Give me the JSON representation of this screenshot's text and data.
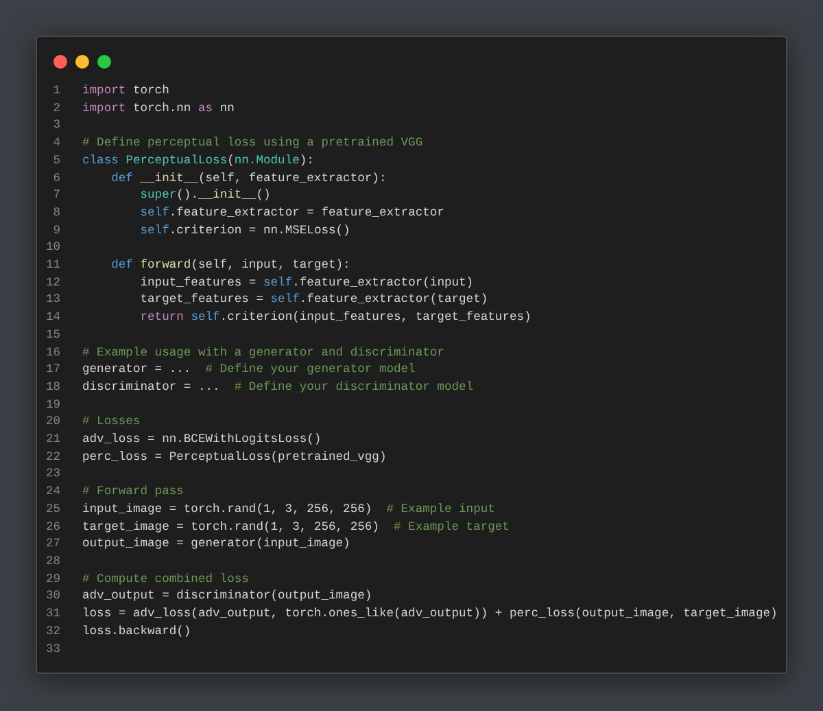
{
  "window": {
    "buttons": [
      {
        "kind": "close"
      },
      {
        "kind": "minimize"
      },
      {
        "kind": "zoom"
      }
    ]
  },
  "lines": [
    {
      "number": "1",
      "tokens": [
        {
          "kind": "kw",
          "text": "import"
        },
        {
          "kind": "tx",
          "text": " torch"
        }
      ]
    },
    {
      "number": "2",
      "tokens": [
        {
          "kind": "kw",
          "text": "import"
        },
        {
          "kind": "tx",
          "text": " torch.nn "
        },
        {
          "kind": "kw",
          "text": "as"
        },
        {
          "kind": "tx",
          "text": " nn"
        }
      ]
    },
    {
      "number": "3"
    },
    {
      "number": "4",
      "tokens": [
        {
          "kind": "cm",
          "text": "# Define perceptual loss using a pretrained VGG"
        }
      ]
    },
    {
      "number": "5",
      "tokens": [
        {
          "kind": "def",
          "text": "class "
        },
        {
          "kind": "cls",
          "text": "PerceptualLoss"
        },
        {
          "kind": "tx",
          "text": "("
        },
        {
          "kind": "cls",
          "text": "nn.Module"
        },
        {
          "kind": "tx",
          "text": "):"
        }
      ]
    },
    {
      "number": "6",
      "tokens": [
        {
          "kind": "def",
          "text": "    def "
        },
        {
          "kind": "fn",
          "text": "__init__"
        },
        {
          "kind": "tx",
          "text": "(self, feature_extractor):"
        }
      ]
    },
    {
      "number": "7",
      "tokens": [
        {
          "kind": "cls",
          "text": "        super"
        },
        {
          "kind": "tx",
          "text": "()."
        },
        {
          "kind": "fn",
          "text": "__init__"
        },
        {
          "kind": "tx",
          "text": "()"
        }
      ]
    },
    {
      "number": "8",
      "tokens": [
        {
          "kind": "def",
          "text": "        self"
        },
        {
          "kind": "tx",
          "text": ".feature_extractor = feature_extractor"
        }
      ]
    },
    {
      "number": "9",
      "tokens": [
        {
          "kind": "def",
          "text": "        self"
        },
        {
          "kind": "tx",
          "text": ".criterion = nn.MSELoss()"
        }
      ]
    },
    {
      "number": "10"
    },
    {
      "number": "11",
      "tokens": [
        {
          "kind": "def",
          "text": "    def "
        },
        {
          "kind": "fn",
          "text": "forward"
        },
        {
          "kind": "tx",
          "text": "(self, input, target):"
        }
      ]
    },
    {
      "number": "12",
      "tokens": [
        {
          "kind": "tx",
          "text": "        input_features = "
        },
        {
          "kind": "def",
          "text": "self"
        },
        {
          "kind": "tx",
          "text": ".feature_extractor(input)"
        }
      ]
    },
    {
      "number": "13",
      "tokens": [
        {
          "kind": "tx",
          "text": "        target_features = "
        },
        {
          "kind": "def",
          "text": "self"
        },
        {
          "kind": "tx",
          "text": ".feature_extractor(target)"
        }
      ]
    },
    {
      "number": "14",
      "tokens": [
        {
          "kind": "kw",
          "text": "        return "
        },
        {
          "kind": "def",
          "text": "self"
        },
        {
          "kind": "tx",
          "text": ".criterion(input_features, target_features)"
        }
      ]
    },
    {
      "number": "15"
    },
    {
      "number": "16",
      "tokens": [
        {
          "kind": "cm",
          "text": "# Example usage with a generator and discriminator"
        }
      ]
    },
    {
      "number": "17",
      "tokens": [
        {
          "kind": "tx",
          "text": "generator = ...  "
        },
        {
          "kind": "cm",
          "text": "# Define your generator model"
        }
      ]
    },
    {
      "number": "18",
      "tokens": [
        {
          "kind": "tx",
          "text": "discriminator = ...  "
        },
        {
          "kind": "cm",
          "text": "# Define your discriminator model"
        }
      ]
    },
    {
      "number": "19"
    },
    {
      "number": "20",
      "tokens": [
        {
          "kind": "cm",
          "text": "# Losses"
        }
      ]
    },
    {
      "number": "21",
      "tokens": [
        {
          "kind": "tx",
          "text": "adv_loss = nn.BCEWithLogitsLoss()"
        }
      ]
    },
    {
      "number": "22",
      "tokens": [
        {
          "kind": "tx",
          "text": "perc_loss = PerceptualLoss(pretrained_vgg)"
        }
      ]
    },
    {
      "number": "23"
    },
    {
      "number": "24",
      "tokens": [
        {
          "kind": "cm",
          "text": "# Forward pass"
        }
      ]
    },
    {
      "number": "25",
      "tokens": [
        {
          "kind": "tx",
          "text": "input_image = torch.rand(1, 3, 256, 256)  "
        },
        {
          "kind": "cm",
          "text": "# Example input"
        }
      ]
    },
    {
      "number": "26",
      "tokens": [
        {
          "kind": "tx",
          "text": "target_image = torch.rand(1, 3, 256, 256)  "
        },
        {
          "kind": "cm",
          "text": "# Example target"
        }
      ]
    },
    {
      "number": "27",
      "tokens": [
        {
          "kind": "tx",
          "text": "output_image = generator(input_image)"
        }
      ]
    },
    {
      "number": "28"
    },
    {
      "number": "29",
      "tokens": [
        {
          "kind": "cm",
          "text": "# Compute combined loss"
        }
      ]
    },
    {
      "number": "30",
      "tokens": [
        {
          "kind": "tx",
          "text": "adv_output = discriminator(output_image)"
        }
      ]
    },
    {
      "number": "31",
      "tokens": [
        {
          "kind": "tx",
          "text": "loss = adv_loss(adv_output, torch.ones_like(adv_output)) + perc_loss(output_image, target_image)"
        }
      ]
    },
    {
      "number": "32",
      "tokens": [
        {
          "kind": "tx",
          "text": "loss.backward()"
        }
      ]
    },
    {
      "number": "33"
    }
  ]
}
